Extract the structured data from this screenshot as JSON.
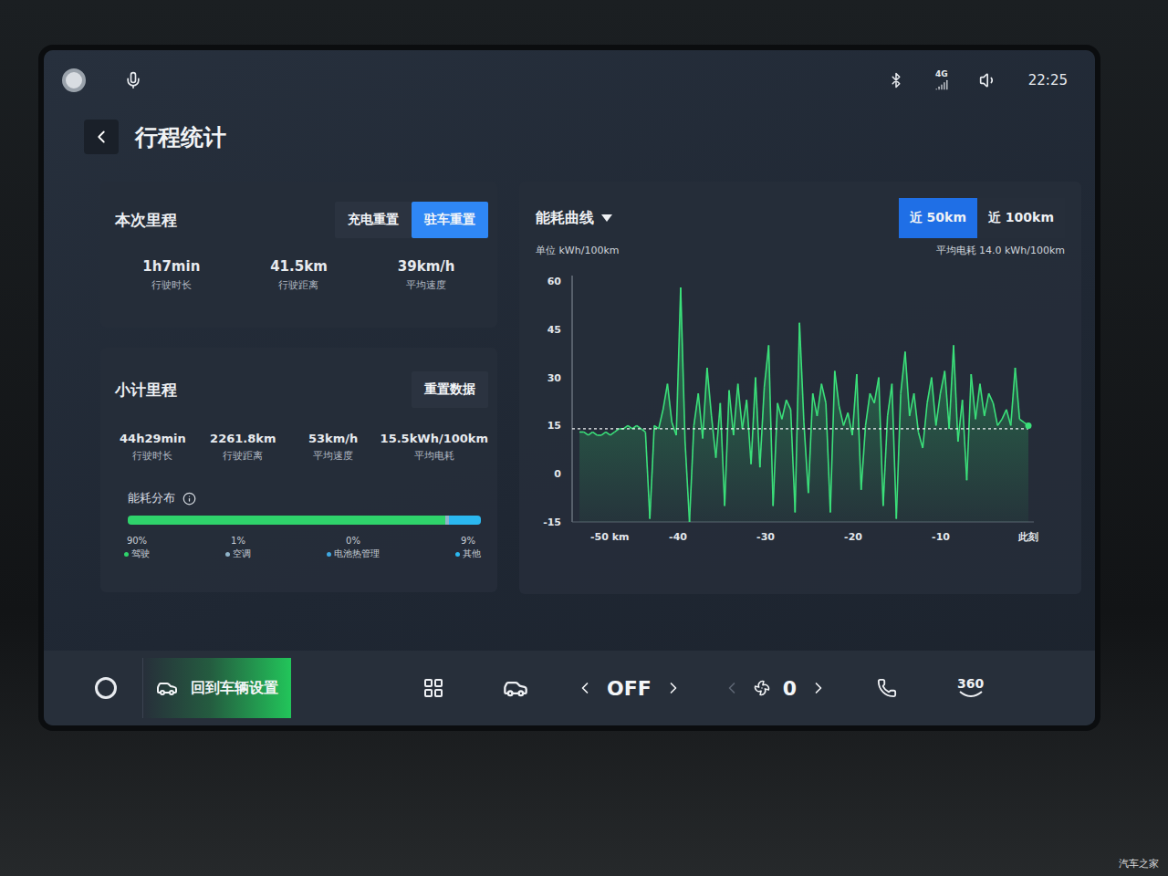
{
  "status_bar": {
    "network": "4G",
    "time": "22:25"
  },
  "header": {
    "title": "行程统计"
  },
  "trip": {
    "title": "本次里程",
    "buttons": [
      {
        "label": "充电重置",
        "selected": false
      },
      {
        "label": "驻车重置",
        "selected": true
      }
    ],
    "stats": [
      {
        "value": "1h7min",
        "label": "行驶时长"
      },
      {
        "value": "41.5km",
        "label": "行驶距离"
      },
      {
        "value": "39km/h",
        "label": "平均速度"
      }
    ]
  },
  "subtotal": {
    "title": "小计里程",
    "reset_button": "重置数据",
    "stats": [
      {
        "value": "44h29min",
        "label": "行驶时长"
      },
      {
        "value": "2261.8km",
        "label": "行驶距离"
      },
      {
        "value": "53km/h",
        "label": "平均速度"
      },
      {
        "value": "15.5kWh/100km",
        "label": "平均电耗"
      }
    ],
    "distribution": {
      "title": "能耗分布",
      "items": [
        {
          "percent": "90%",
          "label": "驾驶",
          "level": 0.9,
          "color": "#2fd36b"
        },
        {
          "percent": "1%",
          "label": "空调",
          "level": 0.01,
          "color": "#8fb3c9"
        },
        {
          "percent": "0%",
          "label": "电池热管理",
          "level": 0.0,
          "color": "#3fa7e0"
        },
        {
          "percent": "9%",
          "label": "其他",
          "level": 0.09,
          "color": "#2bb8f0"
        }
      ]
    }
  },
  "chart": {
    "title": "能耗曲线",
    "unit": "单位 kWh/100km",
    "tabs": [
      {
        "label": "近 50km",
        "selected": true
      },
      {
        "label": "近 100km",
        "selected": false
      }
    ],
    "average_text": "平均电耗 14.0 kWh/100km",
    "average": 14.0,
    "y_ticks": [
      "60",
      "45",
      "30",
      "15",
      "0",
      "-15"
    ],
    "x_ticks": [
      "-50 km",
      "-40",
      "-30",
      "-20",
      "-10",
      "此刻"
    ],
    "series": [
      {
        "values": [
          13,
          13,
          12,
          13,
          12,
          12,
          13,
          12,
          13,
          14,
          14,
          15,
          14,
          15,
          14,
          13,
          -14,
          15,
          14,
          20,
          28,
          16,
          12,
          58,
          10,
          -15,
          15,
          25,
          11,
          33,
          18,
          5,
          22,
          -10,
          26,
          12,
          28,
          14,
          23,
          3,
          30,
          2,
          27,
          40,
          -10,
          22,
          17,
          23,
          20,
          -12,
          47,
          16,
          -6,
          25,
          18,
          28,
          22,
          -12,
          32,
          21,
          15,
          19,
          12,
          31,
          -5,
          15,
          25,
          22,
          30,
          -10,
          18,
          28,
          -14,
          25,
          38,
          18,
          25,
          13,
          8,
          22,
          30,
          15,
          25,
          32,
          14,
          40,
          10,
          23,
          -2,
          31,
          17,
          28,
          18,
          25,
          22,
          15,
          17,
          20,
          15,
          33,
          17,
          16,
          15
        ]
      }
    ]
  },
  "dock": {
    "vehicle_settings": "回到车辆设置",
    "ac": "OFF",
    "fan": "0",
    "camera": "360"
  },
  "watermark": "汽车之家"
}
